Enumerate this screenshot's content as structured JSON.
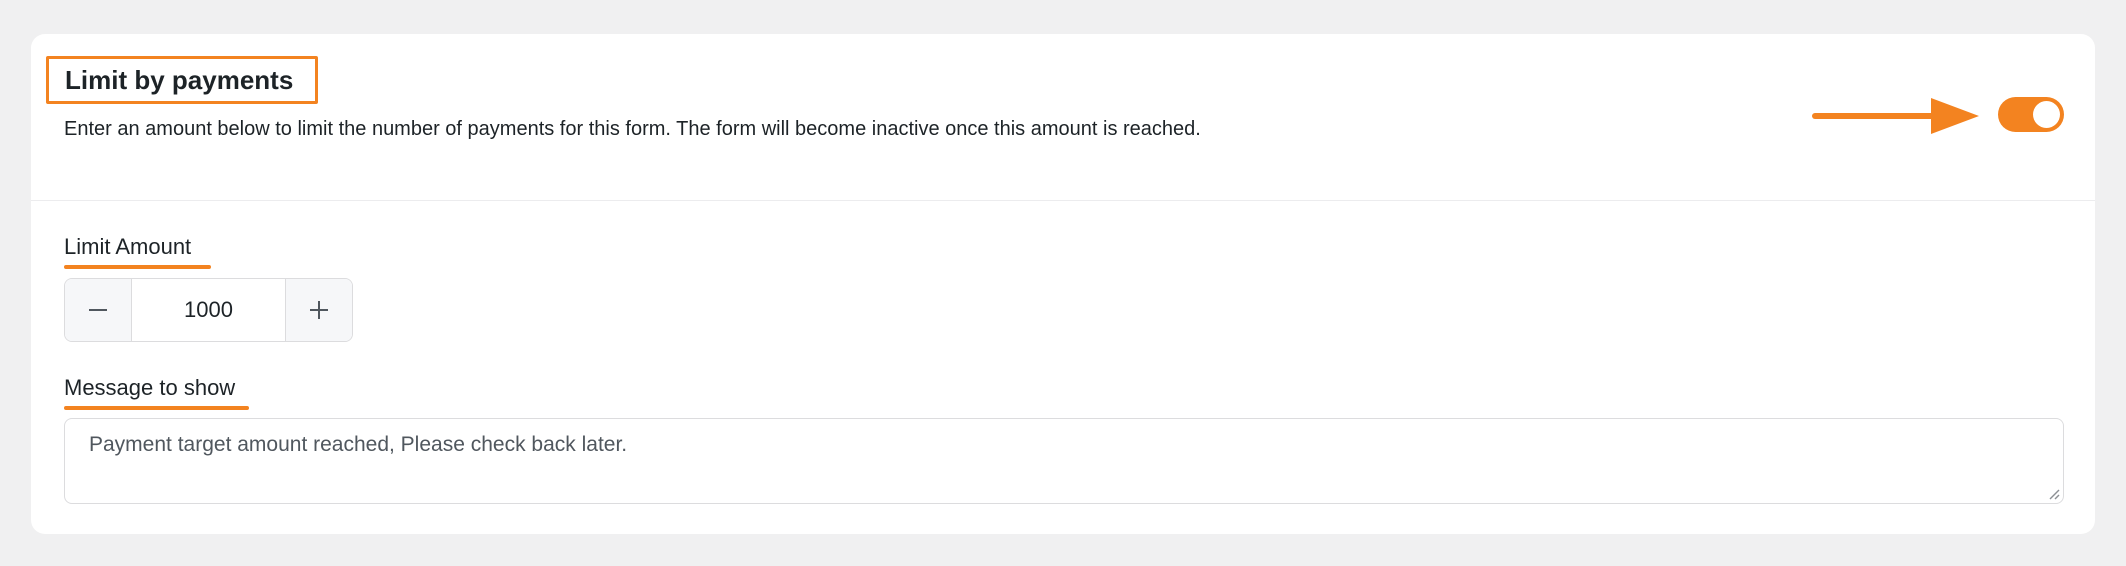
{
  "section": {
    "title": "Limit by payments",
    "description": "Enter an amount below to limit the number of payments for this form. The form will become inactive once this amount is reached.",
    "toggle_enabled": true
  },
  "limit_amount": {
    "label": "Limit Amount",
    "value": "1000",
    "decrement_icon": "minus-icon",
    "increment_icon": "plus-icon"
  },
  "message": {
    "label": "Message to show",
    "value": "Payment target amount reached, Please check back later."
  },
  "colors": {
    "accent": "#f38320",
    "background": "#f0f0f1",
    "card": "#ffffff",
    "text": "#1d2327",
    "muted_text": "#50575e",
    "border": "#dcdcde"
  },
  "icons": {
    "annotation": "arrow-right-icon",
    "resize": "resize-handle-icon"
  }
}
